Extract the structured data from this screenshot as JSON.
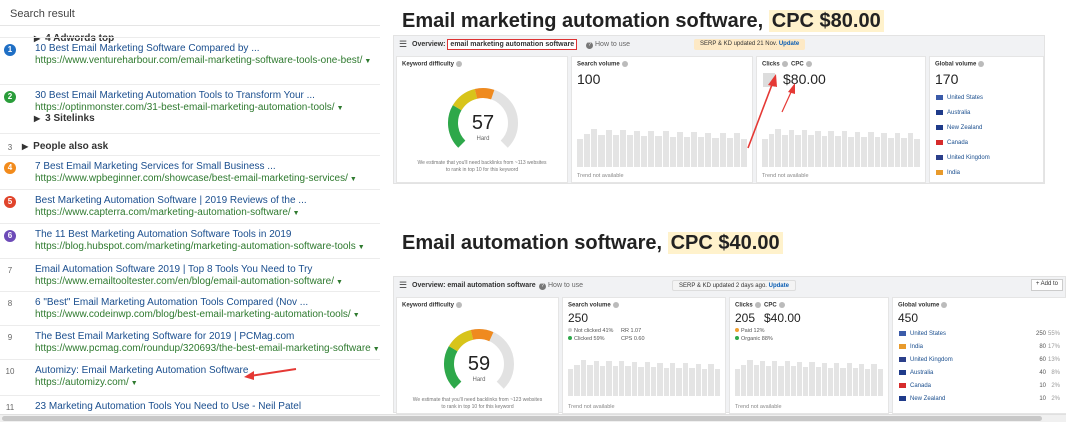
{
  "left": {
    "header": "Search result",
    "adwords": "4 Adwords top",
    "sitelinks": "3 Sitelinks",
    "paa": "People also ask",
    "results": [
      {
        "rank": "1",
        "color": "#1f6fc5",
        "title": "10 Best Email Marketing Software Compared by ...",
        "url": "https://www.ventureharbour.com/email-marketing-software-tools-one-best/"
      },
      {
        "rank": "2",
        "color": "#2a9d3a",
        "title": "30 Best Email Marketing Automation Tools to Transform Your ...",
        "url": "https://optinmonster.com/31-best-email-marketing-automation-tools/"
      },
      {
        "rank": "4",
        "color": "#f28b1c",
        "title": "7 Best Email Marketing Services for Small Business ...",
        "url": "https://www.wpbeginner.com/showcase/best-email-marketing-services/"
      },
      {
        "rank": "5",
        "color": "#e0442b",
        "title": "Best Marketing Automation Software | 2019 Reviews of the ...",
        "url": "https://www.capterra.com/marketing-automation-software/"
      },
      {
        "rank": "6",
        "color": "#6d4bb8",
        "title": "The 11 Best Marketing Automation Software Tools in 2019",
        "url": "https://blog.hubspot.com/marketing/marketing-automation-software-tools"
      },
      {
        "rank": "7",
        "color": "",
        "title": "Email Automation Software 2019 | Top 8 Tools You Need to Try",
        "url": "https://www.emailtooltester.com/en/blog/email-automation-software/"
      },
      {
        "rank": "8",
        "color": "",
        "title": "6 \"Best\" Email Marketing Automation Tools Compared (Nov ...",
        "url": "https://www.codeinwp.com/blog/best-email-marketing-automation-tools/"
      },
      {
        "rank": "9",
        "color": "",
        "title": "The Best Email Marketing Software for 2019 | PCMag.com",
        "url": "https://www.pcmag.com/roundup/320693/the-best-email-marketing-software"
      },
      {
        "rank": "10",
        "color": "",
        "title": "Automizy: Email Marketing Automation Software",
        "url": "https://automizy.com/"
      },
      {
        "rank": "11",
        "color": "",
        "title": "23 Marketing Automation Tools You Need to Use - Neil Patel",
        "url": ""
      }
    ]
  },
  "top": {
    "heading_prefix": "Email marketing automation software, ",
    "heading_cpc": "CPC $80.00",
    "bar_title": "Overview:",
    "keyword": "email marketing automation software",
    "how_to": "How to use",
    "pill_prefix": "SERP & KD updated 21 Nov.",
    "pill_link": "Update",
    "kd_label": "Keyword difficulty",
    "kd_value": "57",
    "kd_level": 0.57,
    "kd_text": "Hard",
    "kd_note1": "We estimate that you'll need backlinks from ~113 websites",
    "kd_note2": "to rank in top 10 for this keyword",
    "sv_label": "Search volume",
    "sv_value": "100",
    "trend_na": "Trend not available",
    "clicks_label": "Clicks",
    "cpc_label": "CPC",
    "cpc_value": "$80.00",
    "gv_label": "Global volume",
    "gv_value": "170",
    "countries": [
      "United States",
      "Australia",
      "New Zealand",
      "Canada",
      "United Kingdom",
      "India"
    ]
  },
  "bottom": {
    "heading_prefix": "Email automation software, ",
    "heading_cpc": "CPC $40.00",
    "bar_title": "Overview: email automation software",
    "how_to": "How to use",
    "pill_prefix": "SERP & KD updated 2 days ago.",
    "pill_link": "Update",
    "add_to": "+ Add to",
    "kd_label": "Keyword difficulty",
    "kd_value": "59",
    "kd_level": 0.59,
    "kd_text": "Hard",
    "kd_note1": "We estimate that you'll need backlinks from ~123 websites",
    "kd_note2": "to rank in top 10 for this keyword",
    "sv_label": "Search volume",
    "sv_value": "250",
    "not_clicked": "Not clicked 41%",
    "clicked": "Clicked 59%",
    "rr": "RR 1.07",
    "cps": "CPS 0.60",
    "trend_na": "Trend not available",
    "clicks_label": "Clicks",
    "cpc_label": "CPC",
    "clicks_value": "205",
    "cpc_value": "$40.00",
    "paid": "Paid 12%",
    "organic": "Organic 88%",
    "gv_label": "Global volume",
    "gv_value": "450",
    "countries": [
      {
        "name": "United States",
        "count": "250",
        "pct": "55%"
      },
      {
        "name": "India",
        "count": "80",
        "pct": "17%"
      },
      {
        "name": "United Kingdom",
        "count": "60",
        "pct": "13%"
      },
      {
        "name": "Australia",
        "count": "40",
        "pct": "8%"
      },
      {
        "name": "Canada",
        "count": "10",
        "pct": "2%"
      },
      {
        "name": "New Zealand",
        "count": "10",
        "pct": "2%"
      }
    ]
  },
  "colors": {
    "link": "#1a4e8e",
    "url": "#2f7a2f",
    "highlight": "#fff2cc",
    "arrow": "#e53935",
    "gauge_green": "#2ea84a",
    "gauge_yellow": "#d8c41a",
    "gauge_orange": "#ef8a1f",
    "gauge_gray": "#e2e2e2"
  },
  "icons": [
    "menu-icon",
    "help-icon",
    "caret-down-icon",
    "triangle-right-icon",
    "red-arrow-icon",
    "flag-icon"
  ]
}
